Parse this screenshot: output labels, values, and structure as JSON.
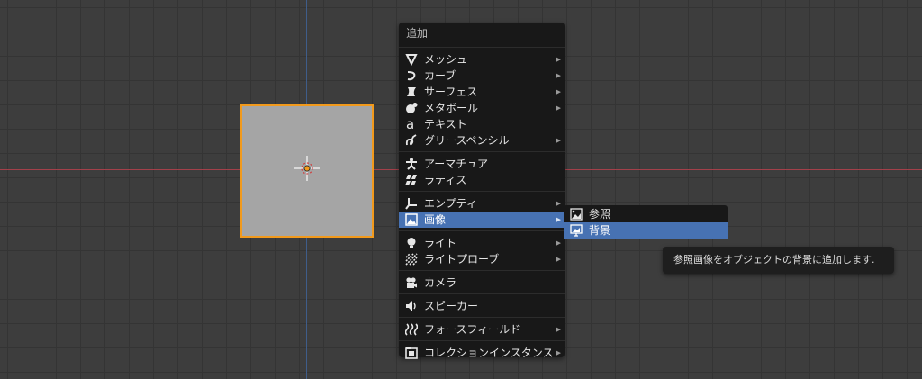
{
  "menu": {
    "title": "追加",
    "groups": [
      [
        {
          "label": "メッシュ",
          "icon": "mesh-icon",
          "submenu": true
        },
        {
          "label": "カーブ",
          "icon": "curve-icon",
          "submenu": true
        },
        {
          "label": "サーフェス",
          "icon": "surface-icon",
          "submenu": true
        },
        {
          "label": "メタボール",
          "icon": "metaball-icon",
          "submenu": true
        },
        {
          "label": "テキスト",
          "icon": "text-icon",
          "submenu": false
        },
        {
          "label": "グリースペンシル",
          "icon": "grease-pencil-icon",
          "submenu": true
        }
      ],
      [
        {
          "label": "アーマチュア",
          "icon": "armature-icon",
          "submenu": false
        },
        {
          "label": "ラティス",
          "icon": "lattice-icon",
          "submenu": false
        }
      ],
      [
        {
          "label": "エンプティ",
          "icon": "empty-icon",
          "submenu": true
        },
        {
          "label": "画像",
          "icon": "image-icon",
          "submenu": true,
          "highlighted": true
        }
      ],
      [
        {
          "label": "ライト",
          "icon": "light-icon",
          "submenu": true
        },
        {
          "label": "ライトプローブ",
          "icon": "light-probe-icon",
          "submenu": true
        }
      ],
      [
        {
          "label": "カメラ",
          "icon": "camera-icon",
          "submenu": false
        }
      ],
      [
        {
          "label": "スピーカー",
          "icon": "speaker-icon",
          "submenu": false
        }
      ],
      [
        {
          "label": "フォースフィールド",
          "icon": "force-field-icon",
          "submenu": true
        }
      ],
      [
        {
          "label": "コレクションインスタンス",
          "icon": "collection-instance-icon",
          "submenu": true
        }
      ]
    ]
  },
  "image_submenu": {
    "items": [
      {
        "label": "参照",
        "icon": "reference-image-icon"
      },
      {
        "label": "背景",
        "icon": "background-image-icon",
        "highlighted": true
      }
    ]
  },
  "tooltip": {
    "text": "参照画像をオブジェクトの背景に追加します."
  },
  "colors": {
    "highlight": "#4772b3",
    "selection_outline": "#f29a1c",
    "x_axis": "#a3404a",
    "y_axis": "#3f5d8a"
  }
}
